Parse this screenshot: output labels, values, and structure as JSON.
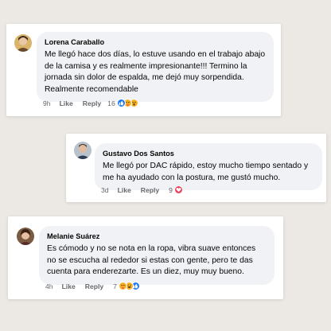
{
  "comments": [
    {
      "name": "Lorena Caraballo",
      "text": "Me llegó hace dos días, lo estuve usando en el trabajo abajo de la camisa y es realmente impresionante!!! Termino la jornada sin dolor de espalda, me dejó muy sorpendida. Realmente recomendable",
      "time": "9h",
      "like": "Like",
      "reply": "Reply",
      "reaction_count": "16",
      "reactions": [
        "like-reaction-icon",
        "care-reaction-icon",
        "wow-reaction-icon"
      ]
    },
    {
      "name": "Gustavo Dos Santos",
      "text": "Me llegó por DAC rápido, estoy mucho tiempo sentado y me ha ayudado con la postura, me gustó mucho.",
      "time": "3d",
      "like": "Like",
      "reply": "Reply",
      "reaction_count": "9",
      "reactions": [
        "love-reaction-icon"
      ]
    },
    {
      "name": "Melanie Suárez",
      "text": "Es cómodo y no se nota en la ropa, vibra suave entonces no se escucha al rededor si estas con gente, pero te das cuenta para enderezarte. Es un diez, muy muy bueno.",
      "time": "4h",
      "like": "Like",
      "reply": "Reply",
      "reaction_count": "7",
      "reactions": [
        "care-reaction-icon",
        "haha-reaction-icon",
        "like-reaction-icon"
      ]
    }
  ],
  "colors": {
    "background": "#ece9e5",
    "bubble": "#f0f2f5",
    "like_blue": "#1877f2",
    "love_red": "#f33e58",
    "emoji_yellow": "#f7b125",
    "meta_gray": "#65676b"
  }
}
